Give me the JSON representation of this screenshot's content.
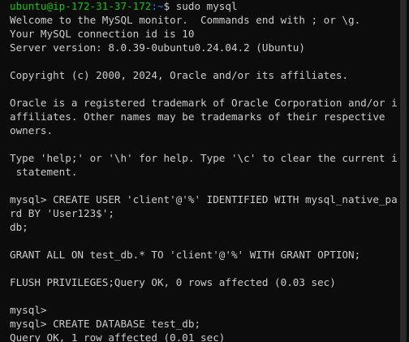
{
  "prompt": {
    "user_host": "ubuntu@ip-172-31-37-172",
    "path": ":~",
    "command": "$ sudo mysql"
  },
  "lines": [
    "Welcome to the MySQL monitor.  Commands end with ; or \\g.",
    "Your MySQL connection id is 10",
    "Server version: 8.0.39-0ubuntu0.24.04.2 (Ubuntu)",
    "",
    "Copyright (c) 2000, 2024, Oracle and/or its affiliates.",
    "",
    "Oracle is a registered trademark of Oracle Corporation and/or its",
    "affiliates. Other names may be trademarks of their respective",
    "owners.",
    "",
    "Type 'help;' or '\\h' for help. Type '\\c' to clear the current input",
    " statement.",
    "",
    "mysql> CREATE USER 'client'@'%' IDENTIFIED WITH mysql_native_passwo",
    "rd BY 'User123$';",
    "db;",
    "",
    "GRANT ALL ON test_db.* TO 'client'@'%' WITH GRANT OPTION;",
    "",
    "FLUSH PRIVILEGES;Query OK, 0 rows affected (0.03 sec)",
    "",
    "mysql>",
    "mysql> CREATE DATABASE test_db;",
    "Query OK, 1 row affected (0.01 sec)"
  ]
}
